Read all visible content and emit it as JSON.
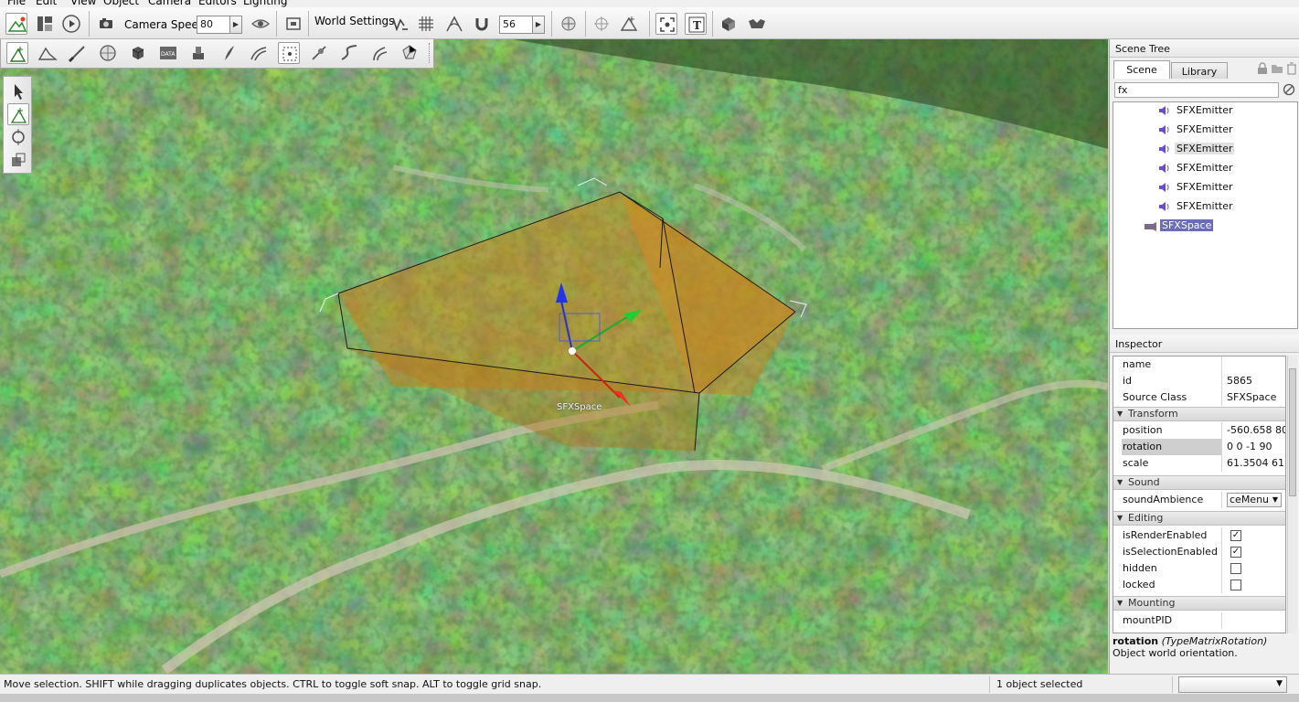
{
  "menu": [
    "File",
    "Edit",
    "View",
    "Object",
    "Camera",
    "Editors",
    "Lighting"
  ],
  "toolbar": {
    "camera_speed_label": "Camera Speed",
    "camera_speed_value": "80",
    "world_settings_label": "World Settings",
    "grid_value": "56"
  },
  "viewport": {
    "object_label": "SFXSpace"
  },
  "scene_tree": {
    "title": "Scene Tree",
    "tabs": [
      "Scene",
      "Library"
    ],
    "filter_value": "fx",
    "items": [
      "SFXEmitter",
      "SFXEmitter",
      "SFXEmitter",
      "SFXEmitter",
      "SFXEmitter",
      "SFXEmitter",
      "SFXSpace"
    ]
  },
  "inspector": {
    "title": "Inspector",
    "props_top": [
      {
        "key": "name",
        "value": ""
      },
      {
        "key": "id",
        "value": "5865"
      },
      {
        "key": "Source Class",
        "value": "SFXSpace"
      }
    ],
    "groups": {
      "transform": "Transform",
      "sound": "Sound",
      "editing": "Editing",
      "mounting": "Mounting"
    },
    "transform": [
      {
        "key": "position",
        "value": "-560.658 80"
      },
      {
        "key": "rotation",
        "value": "0 0 -1 90"
      },
      {
        "key": "scale",
        "value": "61.3504 61.3"
      }
    ],
    "sound": {
      "key": "soundAmbience",
      "value": "ceMenu"
    },
    "editing": [
      {
        "key": "isRenderEnabled",
        "checked": true
      },
      {
        "key": "isSelectionEnabled",
        "checked": true
      },
      {
        "key": "hidden",
        "checked": false
      },
      {
        "key": "locked",
        "checked": false
      }
    ],
    "mounting": [
      {
        "key": "mountPID",
        "value": ""
      }
    ],
    "help_name": "rotation",
    "help_type": "(TypeMatrixRotation)",
    "help_desc": "Object world orientation."
  },
  "status": {
    "message": "Move selection.  SHIFT while dragging duplicates objects.  CTRL to toggle soft snap.  ALT to toggle grid snap.",
    "selection": "1 object selected"
  },
  "colors": {
    "selection": "#6a6db6",
    "volume_fill": "#c8841e"
  }
}
